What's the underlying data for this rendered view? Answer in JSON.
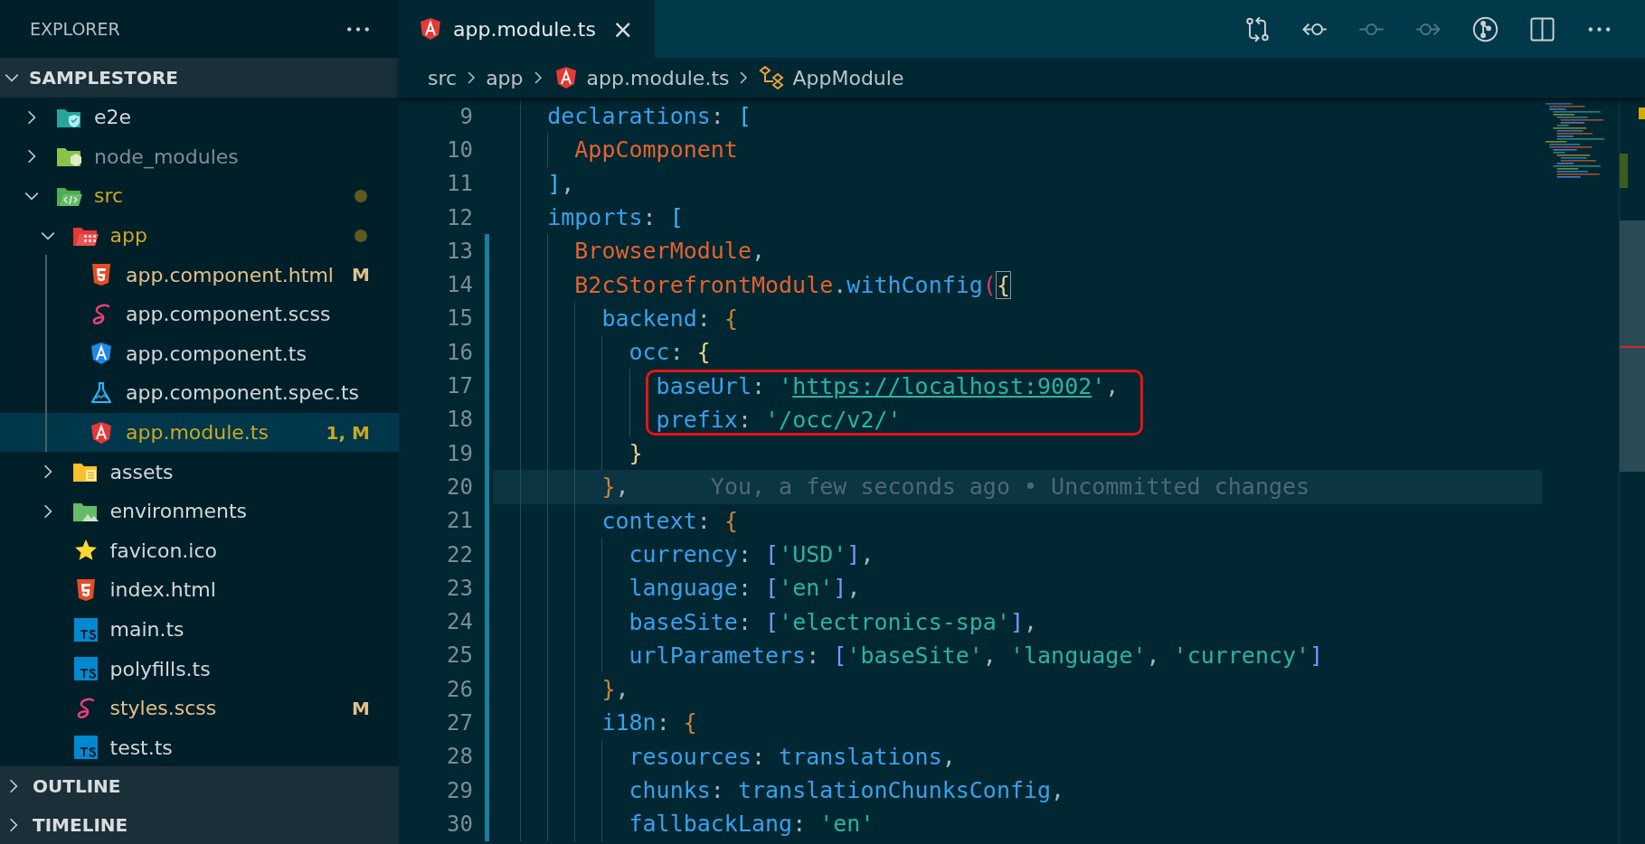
{
  "explorer": {
    "title": "EXPLORER",
    "project": {
      "name": "SAMPLESTORE",
      "expanded": true
    },
    "tree": [
      {
        "name": "e2e",
        "kind": "shieldfolder",
        "expanded": false,
        "selected": false,
        "color": "#d2d8da"
      },
      {
        "name": "node_modules",
        "kind": "nodefolder",
        "expanded": false,
        "selected": false,
        "color": "#7f8d92"
      },
      {
        "name": "src",
        "kind": "codefolder",
        "expanded": true,
        "selected": false,
        "color": "#c9a826",
        "dot": true,
        "children": [
          {
            "name": "app",
            "kind": "appfolder",
            "expanded": true,
            "selected": false,
            "color": "#c9a826",
            "dot": true,
            "children": [
              {
                "name": "app.component.html",
                "kind": "html",
                "selected": false,
                "color": "#e2c08d",
                "badge": "M"
              },
              {
                "name": "app.component.scss",
                "kind": "sass",
                "selected": false,
                "color": "#d2d8da"
              },
              {
                "name": "app.component.ts",
                "kind": "angular",
                "selected": false,
                "color": "#d2d8da"
              },
              {
                "name": "app.component.spec.ts",
                "kind": "test",
                "selected": false,
                "color": "#d2d8da"
              },
              {
                "name": "app.module.ts",
                "kind": "module",
                "selected": true,
                "color": "#c9a826",
                "badge": "1, M"
              }
            ]
          },
          {
            "name": "assets",
            "kind": "assetsfolder",
            "expanded": false,
            "selected": false,
            "color": "#d2d8da"
          },
          {
            "name": "environments",
            "kind": "imagefolder",
            "expanded": false,
            "selected": false,
            "color": "#d2d8da"
          },
          {
            "name": "favicon.ico",
            "kind": "star",
            "selected": false,
            "color": "#d2d8da"
          },
          {
            "name": "index.html",
            "kind": "html",
            "selected": false,
            "color": "#d2d8da"
          },
          {
            "name": "main.ts",
            "kind": "typescript",
            "selected": false,
            "color": "#d2d8da"
          },
          {
            "name": "polyfills.ts",
            "kind": "typescript",
            "selected": false,
            "color": "#d2d8da"
          },
          {
            "name": "styles.scss",
            "kind": "sass",
            "selected": false,
            "color": "#e2c08d",
            "badge": "M"
          },
          {
            "name": "test.ts",
            "kind": "typescript",
            "selected": false,
            "color": "#d2d8da"
          }
        ]
      }
    ],
    "sections": [
      {
        "name": "OUTLINE",
        "expanded": false
      },
      {
        "name": "TIMELINE",
        "expanded": false
      }
    ]
  },
  "tabs": [
    {
      "title": "app.module.ts",
      "kind": "module",
      "selected": true,
      "close": "×"
    }
  ],
  "toolbar": [
    {
      "kind": "compare",
      "disabled": false
    },
    {
      "kind": "previous",
      "disabled": false
    },
    {
      "kind": "commit",
      "disabled": true
    },
    {
      "kind": "next",
      "disabled": true
    },
    {
      "kind": "history",
      "disabled": false
    },
    {
      "kind": "split",
      "disabled": false
    },
    {
      "kind": "more",
      "disabled": false
    }
  ],
  "breadcrumbs": [
    {
      "text": "src",
      "kind": "folder"
    },
    {
      "text": "app",
      "kind": "folder"
    },
    {
      "text": "app.module.ts",
      "kind": "module"
    },
    {
      "text": "AppModule",
      "kind": "class"
    }
  ],
  "editor": {
    "lines": [
      {
        "number": "9",
        "current": false,
        "changed": false,
        "boxed": false,
        "tokens": [
          {
            "text": "declarations",
            "kind": "name"
          },
          {
            "text": ": ",
            "kind": "punct"
          },
          {
            "text": "[",
            "kind": "open1"
          }
        ]
      },
      {
        "number": "10",
        "current": false,
        "changed": false,
        "boxed": false,
        "tokens": [
          {
            "text": "AppComponent",
            "kind": "type"
          }
        ]
      },
      {
        "number": "11",
        "current": false,
        "changed": false,
        "boxed": false,
        "tokens": [
          {
            "text": "]",
            "kind": "close1"
          },
          {
            "text": ",",
            "kind": "punct"
          }
        ]
      },
      {
        "number": "12",
        "current": false,
        "changed": false,
        "boxed": false,
        "tokens": [
          {
            "text": "imports",
            "kind": "name"
          },
          {
            "text": ": ",
            "kind": "punct"
          },
          {
            "text": "[",
            "kind": "open1"
          }
        ]
      },
      {
        "number": "13",
        "current": false,
        "changed": true,
        "boxed": false,
        "tokens": [
          {
            "text": "BrowserModule",
            "kind": "type"
          },
          {
            "text": ",",
            "kind": "punct"
          }
        ]
      },
      {
        "number": "14",
        "current": false,
        "changed": true,
        "boxed": false,
        "tokens": [
          {
            "text": "B2cStorefrontModule",
            "kind": "type"
          },
          {
            "text": ".",
            "kind": "punct"
          },
          {
            "text": "withConfig",
            "kind": "name"
          },
          {
            "text": "(",
            "kind": "open2"
          },
          {
            "text": "{",
            "kind": "openmatch"
          }
        ]
      },
      {
        "number": "15",
        "current": false,
        "changed": true,
        "boxed": false,
        "tokens": [
          {
            "text": "backend",
            "kind": "name"
          },
          {
            "text": ": ",
            "kind": "punct"
          },
          {
            "text": "{",
            "kind": "open4"
          }
        ]
      },
      {
        "number": "16",
        "current": false,
        "changed": true,
        "boxed": false,
        "tokens": [
          {
            "text": "occ",
            "kind": "name"
          },
          {
            "text": ": ",
            "kind": "punct"
          },
          {
            "text": "{",
            "kind": "open3"
          }
        ]
      },
      {
        "number": "17",
        "current": false,
        "changed": true,
        "boxed": true,
        "tokens": [
          {
            "text": "baseUrl",
            "kind": "name"
          },
          {
            "text": ": ",
            "kind": "punct"
          },
          {
            "text": "'",
            "kind": "string"
          },
          {
            "text": "https://localhost:9002",
            "kind": "link"
          },
          {
            "text": "'",
            "kind": "string"
          },
          {
            "text": ",",
            "kind": "punct"
          }
        ]
      },
      {
        "number": "18",
        "current": false,
        "changed": true,
        "boxed": true,
        "tokens": [
          {
            "text": "prefix",
            "kind": "name"
          },
          {
            "text": ": ",
            "kind": "punct"
          },
          {
            "text": "'/occ/v2/'",
            "kind": "string"
          }
        ]
      },
      {
        "number": "19",
        "current": false,
        "changed": true,
        "boxed": false,
        "tokens": [
          {
            "text": "}",
            "kind": "close3"
          }
        ]
      },
      {
        "number": "20",
        "current": true,
        "changed": true,
        "boxed": false,
        "blame": "You, a few seconds ago • Uncommitted changes",
        "tokens": [
          {
            "text": "}",
            "kind": "close4"
          },
          {
            "text": ",",
            "kind": "punct"
          }
        ]
      },
      {
        "number": "21",
        "current": false,
        "changed": true,
        "boxed": false,
        "tokens": [
          {
            "text": "context",
            "kind": "name"
          },
          {
            "text": ": ",
            "kind": "punct"
          },
          {
            "text": "{",
            "kind": "open4"
          }
        ]
      },
      {
        "number": "22",
        "current": false,
        "changed": true,
        "boxed": false,
        "tokens": [
          {
            "text": "currency",
            "kind": "name"
          },
          {
            "text": ": ",
            "kind": "punct"
          },
          {
            "text": "[",
            "kind": "open5"
          },
          {
            "text": "'USD'",
            "kind": "string"
          },
          {
            "text": "]",
            "kind": "close5"
          },
          {
            "text": ",",
            "kind": "punct"
          }
        ]
      },
      {
        "number": "23",
        "current": false,
        "changed": true,
        "boxed": false,
        "tokens": [
          {
            "text": "language",
            "kind": "name"
          },
          {
            "text": ": ",
            "kind": "punct"
          },
          {
            "text": "[",
            "kind": "open5"
          },
          {
            "text": "'en'",
            "kind": "string"
          },
          {
            "text": "]",
            "kind": "close5"
          },
          {
            "text": ",",
            "kind": "punct"
          }
        ]
      },
      {
        "number": "24",
        "current": false,
        "changed": true,
        "boxed": false,
        "tokens": [
          {
            "text": "baseSite",
            "kind": "name"
          },
          {
            "text": ": ",
            "kind": "punct"
          },
          {
            "text": "[",
            "kind": "open5"
          },
          {
            "text": "'electronics-spa'",
            "kind": "string"
          },
          {
            "text": "]",
            "kind": "close5"
          },
          {
            "text": ",",
            "kind": "punct"
          }
        ]
      },
      {
        "number": "25",
        "current": false,
        "changed": true,
        "boxed": false,
        "tokens": [
          {
            "text": "urlParameters",
            "kind": "name"
          },
          {
            "text": ": ",
            "kind": "punct"
          },
          {
            "text": "[",
            "kind": "open5"
          },
          {
            "text": "'baseSite'",
            "kind": "string"
          },
          {
            "text": ", ",
            "kind": "punct"
          },
          {
            "text": "'language'",
            "kind": "string"
          },
          {
            "text": ", ",
            "kind": "punct"
          },
          {
            "text": "'currency'",
            "kind": "string"
          },
          {
            "text": "]",
            "kind": "close5"
          }
        ]
      },
      {
        "number": "26",
        "current": false,
        "changed": true,
        "boxed": false,
        "tokens": [
          {
            "text": "}",
            "kind": "close4"
          },
          {
            "text": ",",
            "kind": "punct"
          }
        ]
      },
      {
        "number": "27",
        "current": false,
        "changed": true,
        "boxed": false,
        "tokens": [
          {
            "text": "i18n",
            "kind": "name"
          },
          {
            "text": ": ",
            "kind": "punct"
          },
          {
            "text": "{",
            "kind": "open4"
          }
        ]
      },
      {
        "number": "28",
        "current": false,
        "changed": true,
        "boxed": false,
        "tokens": [
          {
            "text": "resources",
            "kind": "name"
          },
          {
            "text": ": ",
            "kind": "punct"
          },
          {
            "text": "translations",
            "kind": "name"
          },
          {
            "text": ",",
            "kind": "punct"
          }
        ]
      },
      {
        "number": "29",
        "current": false,
        "changed": true,
        "boxed": false,
        "tokens": [
          {
            "text": "chunks",
            "kind": "name"
          },
          {
            "text": ": ",
            "kind": "punct"
          },
          {
            "text": "translationChunksConfig",
            "kind": "name"
          },
          {
            "text": ",",
            "kind": "punct"
          }
        ]
      },
      {
        "number": "30",
        "current": false,
        "changed": true,
        "boxed": false,
        "tokens": [
          {
            "text": "fallbackLang",
            "kind": "name"
          },
          {
            "text": ": ",
            "kind": "punct"
          },
          {
            "text": "'en'",
            "kind": "string"
          }
        ]
      }
    ]
  }
}
